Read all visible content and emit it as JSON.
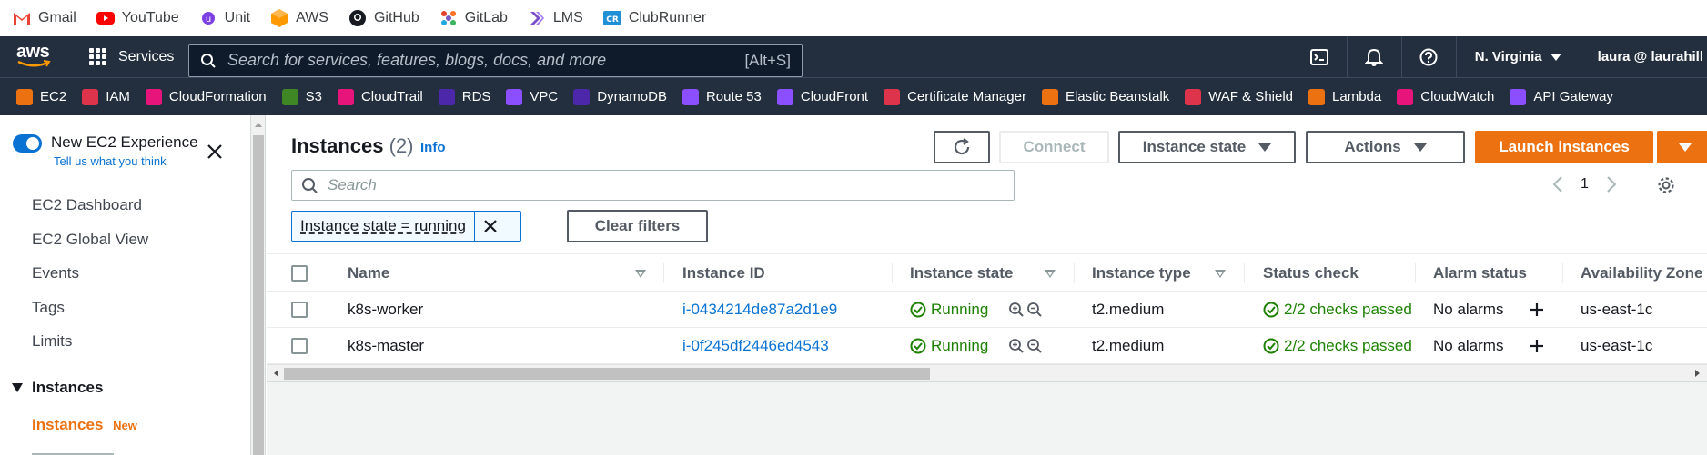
{
  "bookmarks": [
    {
      "label": "Gmail",
      "icon": "gmail-icon"
    },
    {
      "label": "YouTube",
      "icon": "youtube-icon"
    },
    {
      "label": "Unit",
      "icon": "unit-icon"
    },
    {
      "label": "AWS",
      "icon": "aws-cube-icon"
    },
    {
      "label": "GitHub",
      "icon": "github-icon"
    },
    {
      "label": "GitLab",
      "icon": "gitlab-icon"
    },
    {
      "label": "LMS",
      "icon": "lms-icon"
    },
    {
      "label": "ClubRunner",
      "icon": "clubrunner-icon"
    }
  ],
  "topnav": {
    "logo": "aws",
    "services_label": "Services",
    "search_placeholder": "Search for services, features, blogs, docs, and more",
    "search_shortcut": "[Alt+S]",
    "region": "N. Virginia",
    "user": "laura @ laurahill"
  },
  "favorites": [
    {
      "label": "EC2",
      "color": "#ec7211"
    },
    {
      "label": "IAM",
      "color": "#dd344c"
    },
    {
      "label": "CloudFormation",
      "color": "#e7157b"
    },
    {
      "label": "S3",
      "color": "#3f8624"
    },
    {
      "label": "CloudTrail",
      "color": "#e7157b"
    },
    {
      "label": "RDS",
      "color": "#4d27aa"
    },
    {
      "label": "VPC",
      "color": "#8c4fff"
    },
    {
      "label": "DynamoDB",
      "color": "#4d27aa"
    },
    {
      "label": "Route 53",
      "color": "#8c4fff"
    },
    {
      "label": "CloudFront",
      "color": "#8c4fff"
    },
    {
      "label": "Certificate Manager",
      "color": "#dd344c"
    },
    {
      "label": "Elastic Beanstalk",
      "color": "#ec7211"
    },
    {
      "label": "WAF & Shield",
      "color": "#dd344c"
    },
    {
      "label": "Lambda",
      "color": "#ec7211"
    },
    {
      "label": "CloudWatch",
      "color": "#e7157b"
    },
    {
      "label": "API Gateway",
      "color": "#8c4fff"
    }
  ],
  "sidebar": {
    "toggle_title": "New EC2 Experience",
    "toggle_sub": "Tell us what you think",
    "items": [
      "EC2 Dashboard",
      "EC2 Global View",
      "Events",
      "Tags",
      "Limits"
    ],
    "section": "Instances",
    "active_item": "Instances",
    "active_badge": "New"
  },
  "main": {
    "title": "Instances",
    "count": "(2)",
    "info": "Info",
    "buttons": {
      "connect": "Connect",
      "instance_state": "Instance state",
      "actions": "Actions",
      "launch": "Launch instances"
    },
    "search_placeholder": "Search",
    "page": "1",
    "filter_token": "Instance state = running",
    "clear_filters": "Clear filters"
  },
  "table": {
    "columns": [
      "Name",
      "Instance ID",
      "Instance state",
      "Instance type",
      "Status check",
      "Alarm status",
      "Availability Zone"
    ],
    "rows": [
      {
        "name": "k8s-worker",
        "id": "i-0434214de87a2d1e9",
        "state": "Running",
        "type": "t2.medium",
        "status": "2/2 checks passed",
        "alarm": "No alarms",
        "az": "us-east-1c"
      },
      {
        "name": "k8s-master",
        "id": "i-0f245df2446ed4543",
        "state": "Running",
        "type": "t2.medium",
        "status": "2/2 checks passed",
        "alarm": "No alarms",
        "az": "us-east-1c"
      }
    ]
  },
  "colors": {
    "nav_bg": "#232f3e",
    "accent_orange": "#ec7211",
    "link_blue": "#0972d3",
    "success_green": "#1d8102"
  }
}
